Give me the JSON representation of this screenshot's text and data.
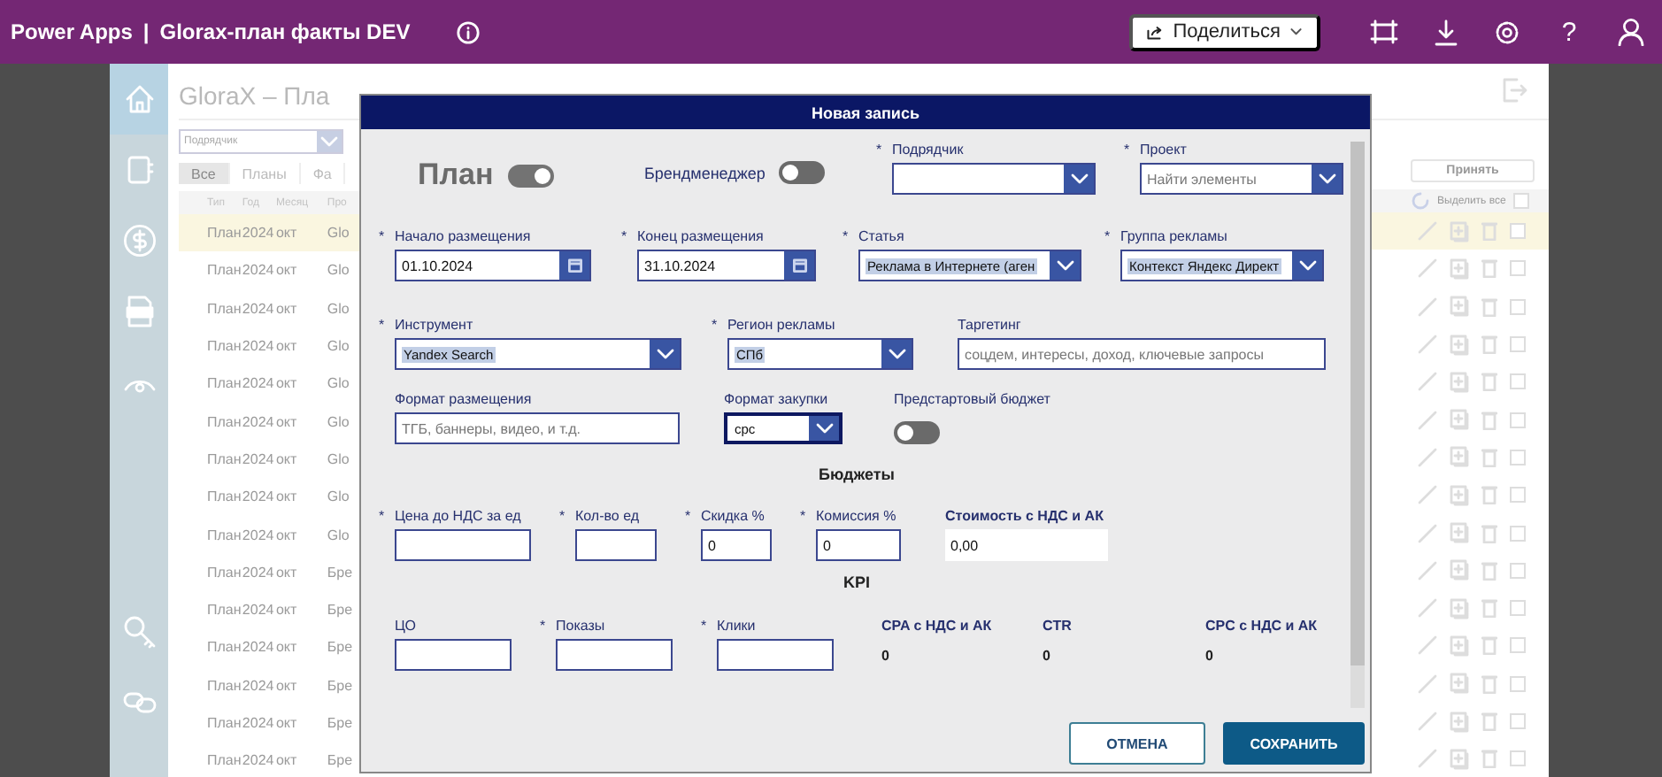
{
  "app_bar": {
    "product": "Power Apps",
    "separator": "|",
    "app_name": "Glorax-план факты DEV",
    "share_button": "Поделиться",
    "help": "?"
  },
  "nav_rail": [
    {
      "kind": "home",
      "selected": true
    },
    {
      "kind": "book",
      "selected": false
    },
    {
      "kind": "dollar",
      "selected": false
    },
    {
      "kind": "pdf",
      "selected": false
    },
    {
      "kind": "eye",
      "selected": false
    },
    {
      "kind": "key",
      "selected": false
    },
    {
      "kind": "link",
      "selected": false
    }
  ],
  "background_page": {
    "title": "GloraX – Пла",
    "contractor_filter": {
      "placeholder": "Подрядчик"
    },
    "tabs": [
      {
        "label": "Все",
        "selected": true
      },
      {
        "label": "Планы",
        "selected": false
      },
      {
        "label": "Фа",
        "selected": false
      }
    ],
    "columns": [
      "Тип",
      "Год",
      "Месяц",
      "Про"
    ],
    "accept_button": "Принять",
    "select_all": {
      "label": "Выделить все",
      "checked": false
    },
    "rows": [
      {
        "type": "План",
        "year": "2024",
        "month": "окт",
        "project": "Glo",
        "highlighted": true,
        "checked": false
      },
      {
        "type": "План",
        "year": "2024",
        "month": "окт",
        "project": "Glo",
        "highlighted": false,
        "checked": false
      },
      {
        "type": "План",
        "year": "2024",
        "month": "окт",
        "project": "Glo",
        "highlighted": false,
        "checked": false
      },
      {
        "type": "План",
        "year": "2024",
        "month": "окт",
        "project": "Glo",
        "highlighted": false,
        "checked": false
      },
      {
        "type": "План",
        "year": "2024",
        "month": "окт",
        "project": "Glo",
        "highlighted": false,
        "checked": false
      },
      {
        "type": "План",
        "year": "2024",
        "month": "окт",
        "project": "Glo",
        "highlighted": false,
        "checked": false
      },
      {
        "type": "План",
        "year": "2024",
        "month": "окт",
        "project": "Glo",
        "highlighted": false,
        "checked": false
      },
      {
        "type": "План",
        "year": "2024",
        "month": "окт",
        "project": "Glo",
        "highlighted": false,
        "checked": false
      },
      {
        "type": "План",
        "year": "2024",
        "month": "окт",
        "project": "Glo",
        "highlighted": false,
        "checked": false
      },
      {
        "type": "План",
        "year": "2024",
        "month": "окт",
        "project": "Бре",
        "highlighted": false,
        "checked": false
      },
      {
        "type": "План",
        "year": "2024",
        "month": "окт",
        "project": "Бре",
        "highlighted": false,
        "checked": false
      },
      {
        "type": "План",
        "year": "2024",
        "month": "окт",
        "project": "Бре",
        "highlighted": false,
        "checked": false
      },
      {
        "type": "План",
        "year": "2024",
        "month": "окт",
        "project": "Бре",
        "highlighted": false,
        "checked": false
      },
      {
        "type": "План",
        "year": "2024",
        "month": "окт",
        "project": "Бре",
        "highlighted": false,
        "checked": false
      },
      {
        "type": "План",
        "year": "2024",
        "month": "окт",
        "project": "Бре",
        "highlighted": false,
        "checked": false
      }
    ]
  },
  "modal": {
    "title": "Новая запись",
    "sections": [
      {
        "kind": "fields",
        "fields": [
          {
            "kind": "title-toggle",
            "label": "План",
            "on": true
          },
          {
            "kind": "inline-toggle",
            "label": "Брендменеджер",
            "on": false
          },
          {
            "kind": "dropdown",
            "required_mark": "*",
            "label": "Подрядчик",
            "focused": false
          },
          {
            "kind": "dropdown",
            "required_mark": "*",
            "label": "Проект",
            "placeholder": "Найти элементы",
            "focused": false
          }
        ]
      },
      {
        "kind": "fields",
        "fields": [
          {
            "kind": "date",
            "required_mark": "*",
            "label": "Начало размещения",
            "value": "01.10.2024"
          },
          {
            "kind": "date",
            "required_mark": "*",
            "label": "Конец размещения",
            "value": "31.10.2024"
          },
          {
            "kind": "dropdown",
            "required_mark": "*",
            "label": "Статья",
            "value": "Реклама в Интернете (аген",
            "highlighted": true,
            "focused": false
          },
          {
            "kind": "dropdown",
            "required_mark": "*",
            "label": "Группа рекламы",
            "value": "Контекст Яндекс Директ",
            "highlighted": true,
            "focused": false
          }
        ]
      },
      {
        "kind": "fields",
        "fields": [
          {
            "kind": "dropdown",
            "required_mark": "*",
            "label": "Инструмент",
            "value": "Yandex Search",
            "highlighted": true,
            "focused": false
          },
          {
            "kind": "dropdown",
            "required_mark": "*",
            "label": "Регион рекламы",
            "value": "СПб",
            "highlighted": true,
            "focused": false
          },
          {
            "kind": "text",
            "label": "Таргетинг",
            "placeholder": "соцдем, интересы, доход, ключевые запросы"
          }
        ]
      },
      {
        "kind": "fields",
        "fields": [
          {
            "kind": "text",
            "label": "Формат размещения",
            "placeholder": "ТГБ, баннеры, видео, и т.д."
          },
          {
            "kind": "dropdown",
            "label": "Формат закупки",
            "value": "cpc",
            "highlighted": false,
            "focused": true
          },
          {
            "kind": "stacked-toggle",
            "label": "Предстартовый бюджет",
            "on": false
          }
        ]
      },
      {
        "kind": "heading",
        "text": "Бюджеты"
      },
      {
        "kind": "fields",
        "fields": [
          {
            "kind": "text",
            "required_mark": "*",
            "label": "Цена до НДС за ед"
          },
          {
            "kind": "text",
            "required_mark": "*",
            "label": "Кол-во ед"
          },
          {
            "kind": "text",
            "required_mark": "*",
            "label": "Скидка %",
            "value": "0"
          },
          {
            "kind": "text",
            "required_mark": "*",
            "label": "Комиссия %",
            "value": "0"
          },
          {
            "kind": "readonly",
            "label": "Стоимость с НДС и АК",
            "value": "0,00"
          }
        ]
      },
      {
        "kind": "heading",
        "text": "KPI"
      },
      {
        "kind": "fields",
        "fields": [
          {
            "kind": "text",
            "label": "ЦО"
          },
          {
            "kind": "text",
            "required_mark": "*",
            "label": "Показы"
          },
          {
            "kind": "text",
            "required_mark": "*",
            "label": "Клики"
          },
          {
            "kind": "output",
            "label": "CPA с НДС и АК",
            "value": "0"
          },
          {
            "kind": "output",
            "label": "CTR",
            "value": "0"
          },
          {
            "kind": "output",
            "label": "CPC с НДС и АК",
            "value": "0"
          }
        ]
      }
    ],
    "buttons": [
      {
        "kind": "secondary",
        "label": "ОТМЕНА"
      },
      {
        "kind": "primary",
        "label": "СОХРАНИТЬ"
      }
    ]
  }
}
